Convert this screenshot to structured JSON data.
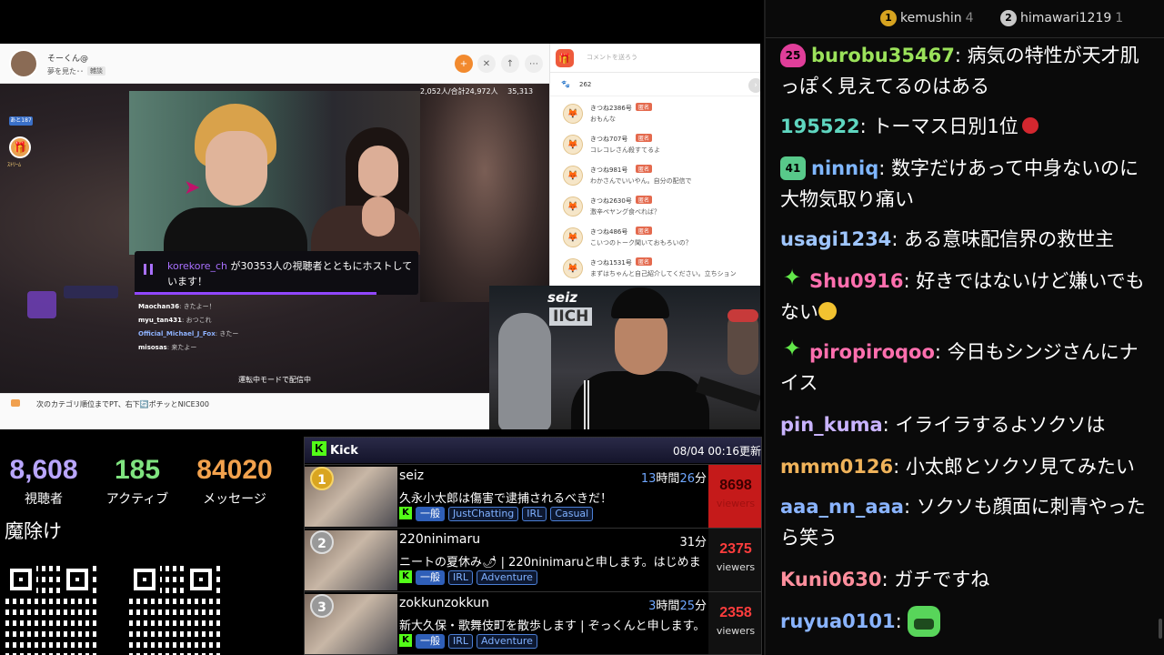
{
  "browser": {
    "streamer_name": "そーくん@",
    "stream_title": "夢を見た･･",
    "stream_tag": "雑談",
    "viewer_stats": {
      "viewers": "2,052人/合計24,972人",
      "comments": "35,313"
    },
    "left_badge": "あと187",
    "gift_label": "ｽﾄﾘｰﾑ",
    "host_notice": {
      "channel": "korekore_ch",
      "text": " が30353人の視聴者とともにホストしています！"
    },
    "mini_chat": [
      {
        "user": "Maochan36",
        "text": "きたよー！"
      },
      {
        "user": "myu_tan431",
        "text": "おつこれ"
      },
      {
        "user": "Official_Michael_J_Fox",
        "text": "きたー"
      },
      {
        "user": "misosas",
        "text": "来たよー"
      }
    ],
    "driving_note": "運転中モードで配信中",
    "footer_text": "次のカテゴリ順位までPT、右下🔄ポチッとNICE300",
    "comment_placeholder": "コメントを送ろう",
    "comment_count": "262",
    "comments": [
      {
        "name": "きつね2386号",
        "badge": "匿名",
        "text": "おもんな"
      },
      {
        "name": "きつね707号",
        "badge": "匿名",
        "text": "コレコレさん殺すてるよ"
      },
      {
        "name": "きつね981号",
        "badge": "匿名",
        "text": "わかさんでいいやん。自分の配信で"
      },
      {
        "name": "きつね2630号",
        "badge": "匿名",
        "text": "激辛ペヤング食べれば？"
      },
      {
        "name": "きつね486号",
        "badge": "匿名",
        "text": "こいつのトーク聞いておもろいの？"
      },
      {
        "name": "きつね1531号",
        "badge": "匿名",
        "text": "まずはちゃんと自己紹介してください。立ちション"
      }
    ],
    "webcam_sign": "seiz",
    "webcam_sign2": "IICH"
  },
  "stats": {
    "viewers": {
      "value": "8,608",
      "label": "視聴者"
    },
    "active": {
      "value": "185",
      "label": "アクティブ"
    },
    "messages": {
      "value": "84020",
      "label": "メッセージ"
    }
  },
  "amulet_label": "魔除け",
  "ranking": {
    "platform": "Kick",
    "updated": "08/04 00:16更新",
    "rows": [
      {
        "rank": "1",
        "name": "seiz",
        "time_hours": "13",
        "time_h_unit": "時間",
        "time_minutes": "26",
        "time_m_unit": "分",
        "title": "久永小太郎は傷害で逮捕されるべきだ！",
        "tags": [
          "JustChatting",
          "IRL",
          "Casual"
        ],
        "viewers": "8698",
        "viewers_label": "viewers"
      },
      {
        "rank": "2",
        "name": "220ninimaru",
        "time_hours": "",
        "time_h_unit": "",
        "time_minutes": "31",
        "time_m_unit": "分",
        "title": "ニートの夏休み🌶 | 220ninimaruと申します。はじめま",
        "tags": [
          "IRL",
          "Adventure"
        ],
        "viewers": "2375",
        "viewers_label": "viewers"
      },
      {
        "rank": "3",
        "name": "zokkunzokkun",
        "time_hours": "3",
        "time_h_unit": "時間",
        "time_minutes": "25",
        "time_m_unit": "分",
        "title": "新大久保・歌舞伎町を散歩します | ぞっくんと申します。",
        "tags": [
          "IRL",
          "Adventure"
        ],
        "viewers": "2358",
        "viewers_label": "viewers"
      }
    ],
    "ippan_label": "一般"
  },
  "chat": {
    "top_users": [
      {
        "name": "kemushin",
        "count": "4",
        "medal": "1"
      },
      {
        "name": "himawari1219",
        "count": "1",
        "medal": "2"
      }
    ],
    "messages": [
      {
        "badge": "25",
        "user": "burobu35467",
        "color": "#9be25a",
        "text": "病気の特性が天才肌っぽく見えてるのはある"
      },
      {
        "badge": "",
        "user": "195522",
        "color": "#5fd6c0",
        "text": "トーマス日別1位"
      },
      {
        "badge": "41",
        "user": "ninniq",
        "color": "#7fb6ff",
        "text": "数字だけあって中身ないのに大物気取り痛い"
      },
      {
        "badge": "",
        "user": "usagi1234",
        "color": "#9fc6ff",
        "text": "ある意味配信界の救世主"
      },
      {
        "badge": "star",
        "user": "Shu0916",
        "color": "#ff6fae",
        "text": "好きではないけど嫌いでもない"
      },
      {
        "badge": "star",
        "user": "piropiroqoo",
        "color": "#ff6fae",
        "text": "今日もシンジさんにナイス"
      },
      {
        "badge": "",
        "user": "pin_kuma",
        "color": "#c9b3ff",
        "text": "イライラするよソクソは"
      },
      {
        "badge": "",
        "user": "mmm0126",
        "color": "#f0b35a",
        "text": "小太郎とソクソ見てみたい"
      },
      {
        "badge": "",
        "user": "aaa_nn_aaa",
        "color": "#8ab4ff",
        "text": "ソクソも顔面に刺青やったら笑う"
      },
      {
        "badge": "",
        "user": "Kuni0630",
        "color": "#ff8f9d",
        "text": "ガチですね"
      },
      {
        "badge": "",
        "user": "ruyua0101",
        "color": "#8ab4ff",
        "text": ""
      }
    ]
  },
  "colors": {
    "kick_green": "#53fc18",
    "accent_purple": "#9147ff",
    "rank_red": "#c51a1a"
  }
}
